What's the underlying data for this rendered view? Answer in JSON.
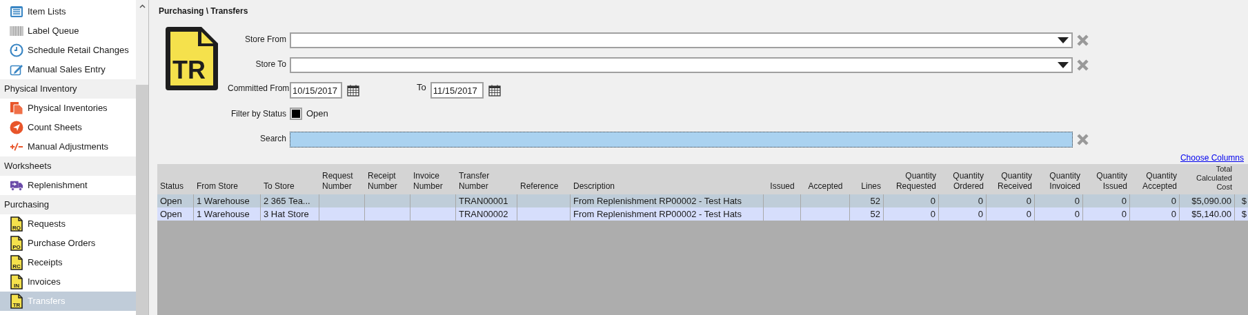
{
  "sidebar": {
    "items": [
      {
        "kind": "item",
        "label": "Item Lists",
        "selected": false
      },
      {
        "kind": "item",
        "label": "Label Queue",
        "selected": false
      },
      {
        "kind": "item",
        "label": "Schedule Retail Changes",
        "selected": false
      },
      {
        "kind": "item",
        "label": "Manual Sales Entry",
        "selected": false
      },
      {
        "kind": "header",
        "label": "Physical Inventory"
      },
      {
        "kind": "item",
        "label": "Physical Inventories",
        "selected": false
      },
      {
        "kind": "item",
        "label": "Count Sheets",
        "selected": false
      },
      {
        "kind": "item",
        "label": "Manual Adjustments",
        "selected": false
      },
      {
        "kind": "header",
        "label": "Worksheets"
      },
      {
        "kind": "item",
        "label": "Replenishment",
        "selected": false
      },
      {
        "kind": "header",
        "label": "Purchasing"
      },
      {
        "kind": "item",
        "label": "Requests",
        "badge": "RQ",
        "selected": false
      },
      {
        "kind": "item",
        "label": "Purchase Orders",
        "badge": "PO",
        "selected": false
      },
      {
        "kind": "item",
        "label": "Receipts",
        "badge": "RC",
        "selected": false
      },
      {
        "kind": "item",
        "label": "Invoices",
        "badge": "IN",
        "selected": false
      },
      {
        "kind": "item",
        "label": "Transfers",
        "badge": "TR",
        "selected": true
      }
    ]
  },
  "breadcrumb": "Purchasing \\ Transfers",
  "page_icon_text": "TR",
  "filters": {
    "store_from": {
      "label": "Store From"
    },
    "store_to": {
      "label": "Store To"
    },
    "committed_from": {
      "label": "Committed From",
      "value": "10/15/2017"
    },
    "committed_to": {
      "label": "To",
      "value": "11/15/2017"
    },
    "status": {
      "label": "Filter by Status",
      "option": "Open",
      "checked": true
    },
    "search": {
      "label": "Search"
    }
  },
  "choose_columns": "Choose Columns",
  "table": {
    "columns": [
      "Status",
      "From Store",
      "To Store",
      "Request Number",
      "Receipt Number",
      "Invoice Number",
      "Transfer Number",
      "Reference",
      "Description",
      "Issued",
      "Accepted",
      "Lines",
      "Quantity Requested",
      "Quantity Ordered",
      "Quantity Received",
      "Quantity Invoiced",
      "Quantity Issued",
      "Quantity Accepted",
      "Total Calculated Cost"
    ],
    "rows": [
      {
        "selected": true,
        "cells": [
          "Open",
          "1 Warehouse",
          "2 365 Tea...",
          "",
          "",
          "",
          "TRAN00001",
          "",
          "From Replenishment RP00002 - Test Hats",
          "",
          "",
          "52",
          "0",
          "0",
          "0",
          "0",
          "0",
          "0",
          "$5,090.00",
          "$"
        ]
      },
      {
        "selected": false,
        "cells": [
          "Open",
          "1 Warehouse",
          "3 Hat Store",
          "",
          "",
          "",
          "TRAN00002",
          "",
          "From Replenishment RP00002 - Test Hats",
          "",
          "",
          "52",
          "0",
          "0",
          "0",
          "0",
          "0",
          "0",
          "$5,140.00",
          "$"
        ]
      }
    ]
  }
}
